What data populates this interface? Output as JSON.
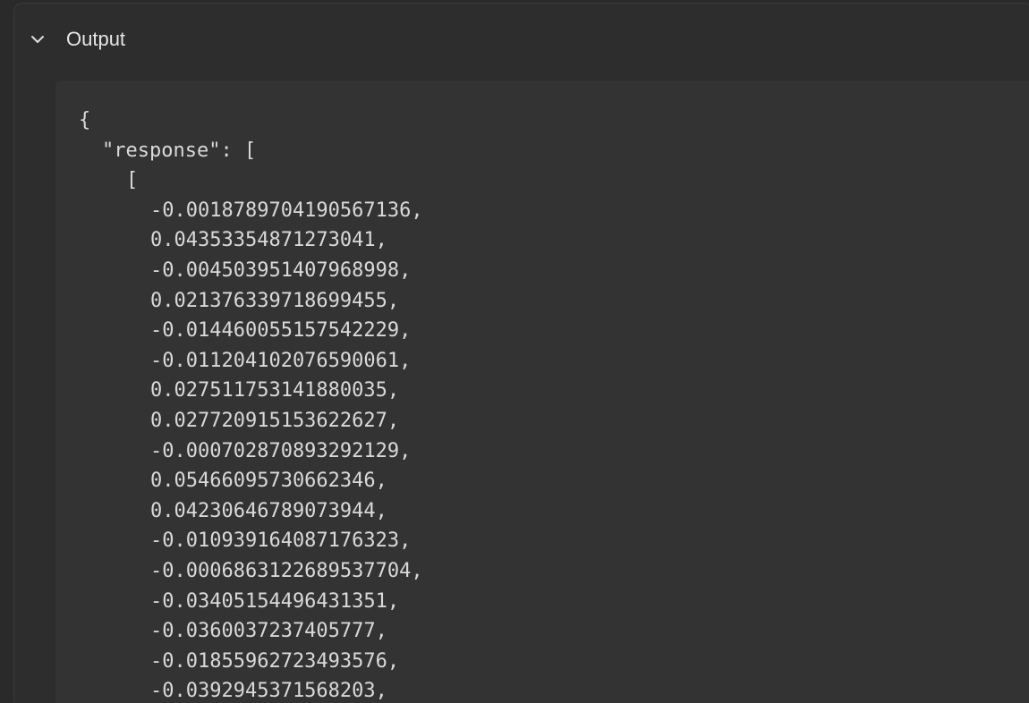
{
  "section": {
    "title": "Output",
    "expanded": true
  },
  "output": {
    "open_brace": "{",
    "response_key_line": "\"response\": [",
    "inner_open_bracket": "[",
    "values": [
      "-0.0018789704190567136,",
      "0.04353354871273041,",
      "-0.004503951407968998,",
      "0.021376339718699455,",
      "-0.014460055157542229,",
      "-0.011204102076590061,",
      "0.027511753141880035,",
      "0.027720915153622627,",
      "-0.000702870893292129,",
      "0.05466095730662346,",
      "0.04230646789073944,",
      "-0.010939164087176323,",
      "-0.0006863122689537704,",
      "-0.03405154496431351,",
      "-0.0360037237405777,",
      "-0.01855962723493576,",
      "-0.0392945371568203,"
    ]
  },
  "colors": {
    "background": "#2a2a2a",
    "panel": "#2d2d2d",
    "code_background": "#333333",
    "text": "#d9d9d9"
  }
}
